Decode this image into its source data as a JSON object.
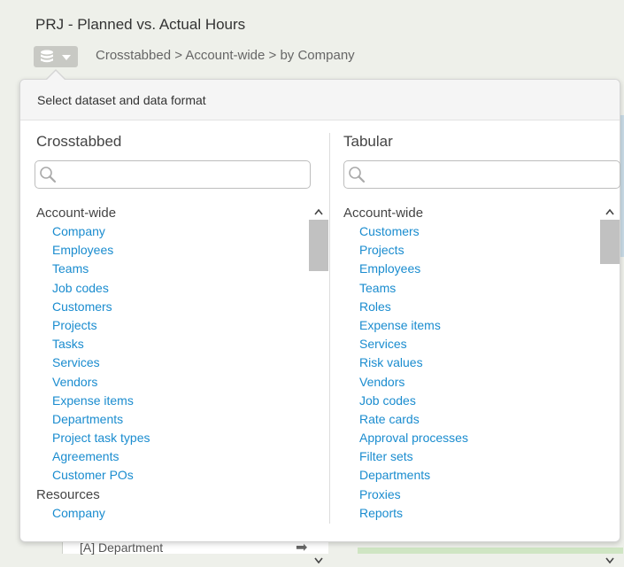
{
  "page": {
    "title": "PRJ - Planned vs. Actual Hours",
    "breadcrumb": "Crosstabbed > Account-wide > by Company"
  },
  "background": {
    "row_label": "[A] Department",
    "row_arrow": "➡"
  },
  "popup": {
    "header": "Select dataset and data format",
    "crosstabbed": {
      "title": "Crosstabbed",
      "search_value": "",
      "groups": [
        {
          "label": "Account-wide",
          "items": [
            "Company",
            "Employees",
            "Teams",
            "Job codes",
            "Customers",
            "Projects",
            "Tasks",
            "Services",
            "Vendors",
            "Expense items",
            "Departments",
            "Project task types",
            "Agreements",
            "Customer POs"
          ]
        },
        {
          "label": "Resources",
          "items": [
            "Company"
          ]
        }
      ]
    },
    "tabular": {
      "title": "Tabular",
      "search_value": "",
      "groups": [
        {
          "label": "Account-wide",
          "items": [
            "Customers",
            "Projects",
            "Employees",
            "Teams",
            "Roles",
            "Expense items",
            "Services",
            "Risk values",
            "Vendors",
            "Job codes",
            "Rate cards",
            "Approval processes",
            "Filter sets",
            "Departments",
            "Proxies",
            "Reports"
          ]
        }
      ]
    }
  },
  "colors": {
    "link": "#1a8ccf",
    "dataset_button": "#c8c9c4",
    "background": "#eef0ea"
  },
  "icons": {
    "dataset": "database-icon",
    "dropdown": "caret-down-icon",
    "search": "magnifier-icon",
    "scroll_up": "chevron-up-icon",
    "scroll_down": "chevron-down-icon"
  }
}
